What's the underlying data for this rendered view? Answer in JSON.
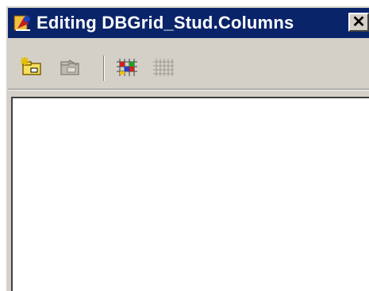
{
  "window": {
    "title": "Editing DBGrid_Stud.Columns",
    "close_glyph": "✕"
  },
  "icons": {
    "app": "delphi-app-icon",
    "close": "close-icon"
  },
  "toolbar": {
    "buttons": [
      {
        "name": "add-new-icon",
        "enabled": true
      },
      {
        "name": "delete-selected-icon",
        "enabled": false
      },
      {
        "name": "add-all-fields-icon",
        "enabled": true
      },
      {
        "name": "restore-defaults-icon",
        "enabled": false
      }
    ]
  },
  "colors": {
    "titlebar": "#0a246a",
    "face": "#d4d0c8",
    "list_background": "#ffffff"
  }
}
